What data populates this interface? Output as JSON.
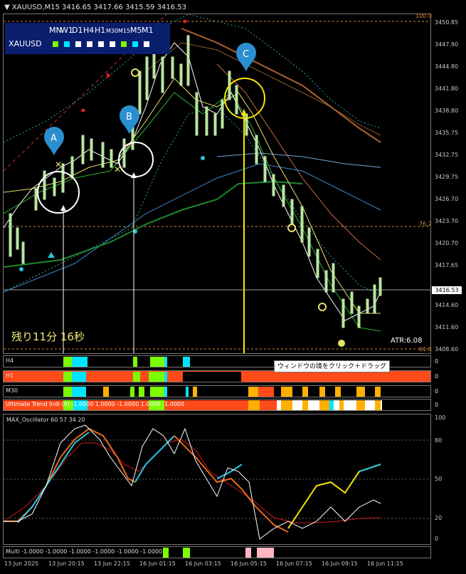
{
  "window": {
    "symbol_title": "XAUUSD,M15",
    "bid_ohlc": "3416.65 3417.66 3415.59 3416.53"
  },
  "mtf_panel": {
    "timeframes": [
      {
        "label": "MN",
        "small": false
      },
      {
        "label": "W1",
        "small": false
      },
      {
        "label": "D1",
        "small": false
      },
      {
        "label": "H4",
        "small": false
      },
      {
        "label": "H1",
        "small": false
      },
      {
        "label": "M30",
        "small": true
      },
      {
        "label": "M15",
        "small": true
      },
      {
        "label": "M5",
        "small": false
      },
      {
        "label": "M1",
        "small": false
      }
    ],
    "symbol": "XAUUSD",
    "status_colors": [
      "#7cfc00",
      "#00e5ff",
      "#ffffff",
      "#ffffff",
      "#ffffff",
      "#ffffff",
      "#7cfc00",
      "#00e5ff",
      "#ffffff"
    ]
  },
  "price_axis": {
    "labels": [
      "3450.85",
      "3447.90",
      "3444.80",
      "3441.80",
      "3438.80",
      "3435.75",
      "3432.75",
      "3429.75",
      "3426.70",
      "3423.70",
      "3420.70",
      "3417.65",
      "3414.60",
      "3411.60",
      "3408.60"
    ],
    "current_price": "3416.53"
  },
  "fibo": {
    "top": "100.0",
    "mid": "76.2",
    "bottom": "61.8"
  },
  "pins": [
    "A",
    "B",
    "C"
  ],
  "timer_text": "残り11分 16秒",
  "atr_text": "ATR:6.08",
  "tooltip_text": "ウィンドウの境をクリック＋ドラッグ",
  "strips": {
    "h4": {
      "label": "H4",
      "side": "0"
    },
    "h1": {
      "label": "H1",
      "side": "0"
    },
    "m30": {
      "label": "M30",
      "side": "0"
    },
    "ultimate": {
      "label": "Ultimate Trend Indi (9) -1.0000 1.0000 -1.0000 1.0000 -1.0000",
      "side": "0"
    },
    "multi": {
      "label": "Multi -1.0000 -1.0000 -1.0000 -1.0000 -1.0000 -1.0000"
    }
  },
  "oscillator": {
    "title": "MAX_Oscillator 60 57 34 20",
    "levels": [
      "100",
      "80",
      "50",
      "20",
      "0"
    ]
  },
  "time_axis": [
    "13 Jun 2025",
    "13 Jun 20:15",
    "13 Jun 22:15",
    "16 Jun 01:15",
    "16 Jun 03:15",
    "16 Jun 05:15",
    "16 Jun 07:15",
    "16 Jun 09:15",
    "16 Jun 11:15"
  ]
}
